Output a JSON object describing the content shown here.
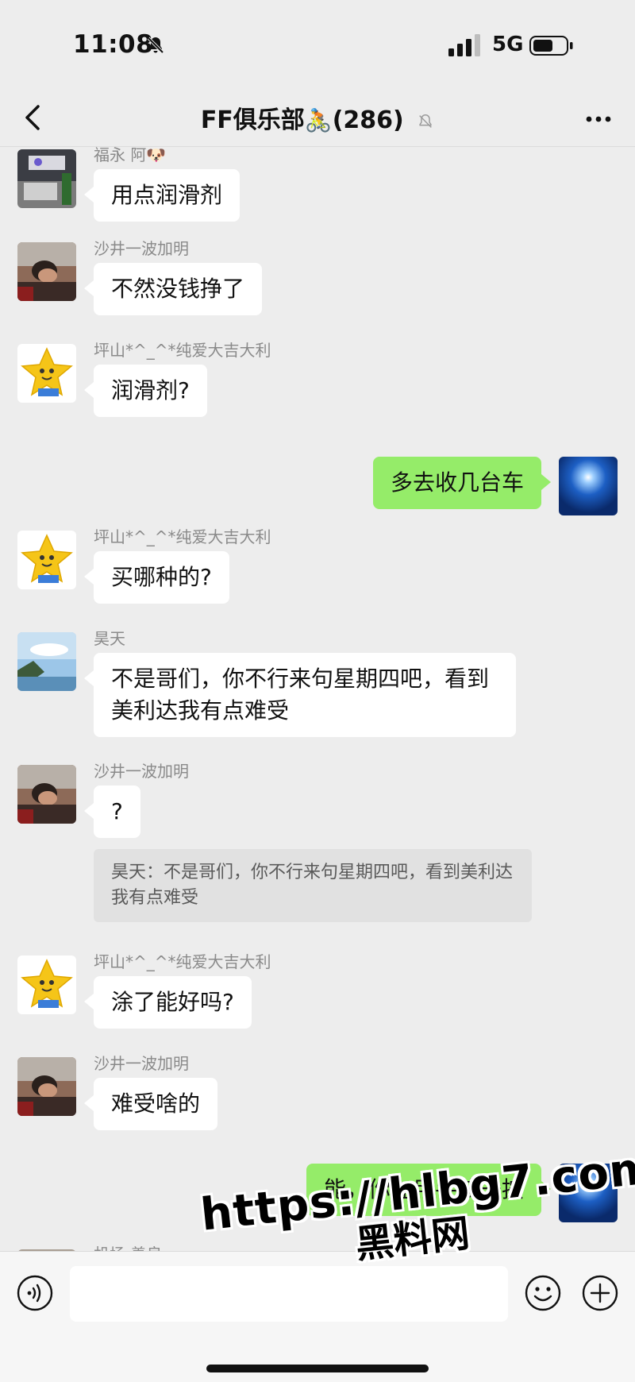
{
  "status": {
    "time": "11:08",
    "network": "5G"
  },
  "header": {
    "title": "FF俱乐部",
    "title_emoji": "🚴",
    "member_count": "(286)"
  },
  "messages": [
    {
      "nickname": "福永 阿🐶",
      "text": "用点润滑剂",
      "avatar": "office-avatar"
    },
    {
      "nickname": "沙井一波加明",
      "text": "不然没钱挣了",
      "avatar": "sleeping-man-avatar"
    },
    {
      "nickname": "坪山*^_^*纯爱大吉大利",
      "text": "润滑剂?",
      "avatar": "star-avatar"
    },
    {
      "text": "多去收几台车",
      "avatar": "blue-light-avatar"
    },
    {
      "nickname": "坪山*^_^*纯爱大吉大利",
      "text": "买哪种的?",
      "avatar": "star-avatar"
    },
    {
      "nickname": "昊天",
      "text": "不是哥们，你不行来句星期四吧，看到美利达我有点难受",
      "avatar": "landscape-avatar"
    },
    {
      "nickname": "沙井一波加明",
      "text": "?",
      "avatar": "sleeping-man-avatar",
      "quote": "昊天：不是哥们，你不行来句星期四吧，看到美利达我有点难受"
    },
    {
      "nickname": "坪山*^_^*纯爱大吉大利",
      "text": "涂了能好吗?",
      "avatar": "star-avatar"
    },
    {
      "nickname": "沙井一波加明",
      "text": "难受啥的",
      "avatar": "sleeping-man-avatar"
    },
    {
      "text": "能，你在用手按一按",
      "avatar": "blue-light-avatar"
    },
    {
      "nickname": "机场 善良",
      "avatar": "partial-avatar"
    }
  ],
  "watermark": {
    "line1": "https://hlbg7.com",
    "line2": "黑料网"
  },
  "colors": {
    "background": "#ededed",
    "incoming_bubble": "#ffffff",
    "outgoing_bubble": "#95ec69",
    "nickname": "#8a8a8a"
  },
  "icons": [
    "bell-off-icon",
    "signal-icon",
    "battery-icon",
    "back-icon",
    "mute-icon",
    "more-icon",
    "voice-icon",
    "emoji-icon",
    "plus-icon"
  ]
}
